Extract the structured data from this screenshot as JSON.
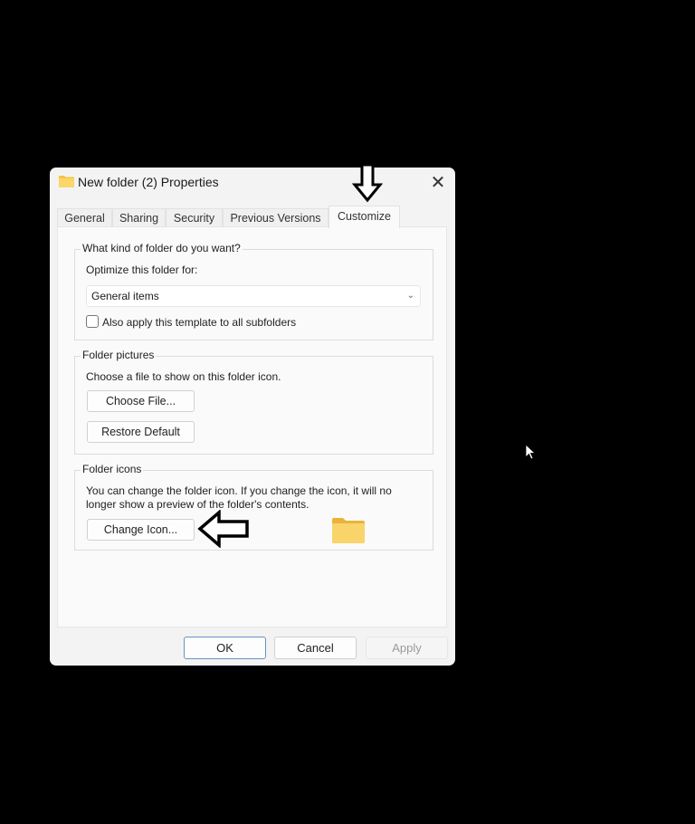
{
  "window": {
    "title": "New folder (2) Properties",
    "close_icon": "close-icon"
  },
  "tabs": [
    {
      "label": "General",
      "active": false
    },
    {
      "label": "Sharing",
      "active": false
    },
    {
      "label": "Security",
      "active": false
    },
    {
      "label": "Previous Versions",
      "active": false
    },
    {
      "label": "Customize",
      "active": true
    }
  ],
  "kind_group": {
    "label": "What kind of folder do you want?",
    "optimize_label": "Optimize this folder for:",
    "optimize_value": "General items",
    "apply_subfolders_label": "Also apply this template to all subfolders",
    "apply_subfolders_checked": false
  },
  "pictures_group": {
    "label": "Folder pictures",
    "description": "Choose a file to show on this folder icon.",
    "choose_file_label": "Choose File...",
    "restore_default_label": "Restore Default"
  },
  "icons_group": {
    "label": "Folder icons",
    "description_line1": "You can change the folder icon. If you change the icon, it will no",
    "description_line2": "longer show a preview of the folder's contents.",
    "change_icon_label": "Change Icon..."
  },
  "footer": {
    "ok_label": "OK",
    "cancel_label": "Cancel",
    "apply_label": "Apply",
    "apply_enabled": false
  },
  "colors": {
    "folder_yellow": "#f7c948",
    "ok_border": "#6a92c0"
  }
}
